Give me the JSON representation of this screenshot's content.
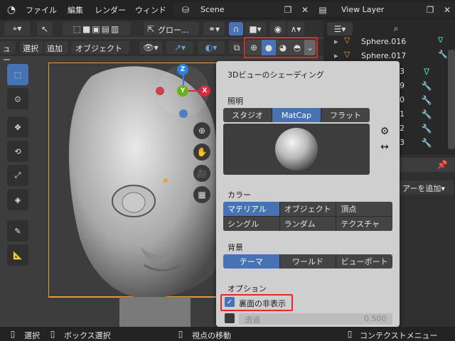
{
  "menubar": {
    "items": [
      "ファイル",
      "編集",
      "レンダー",
      "ウィンド"
    ],
    "scene": "Scene",
    "view_layer": "View Layer"
  },
  "vp_header": {
    "transform": "グロー...",
    "menus": [
      "ュー",
      "選択",
      "追加",
      "オブジェクト"
    ]
  },
  "outliner": {
    "rows": [
      {
        "name": "Sphere.016",
        "tag": ""
      },
      {
        "name": "Sphere.017",
        "tag": ""
      },
      {
        "tag": "3"
      },
      {
        "tag": "9"
      },
      {
        "tag": "0"
      },
      {
        "tag": "1"
      },
      {
        "tag": "2"
      },
      {
        "tag": "3"
      }
    ]
  },
  "props": {
    "add_label": "アーを追加"
  },
  "gizmo": {
    "z": "Z",
    "y": "Y",
    "x": "X"
  },
  "popover": {
    "title": "3Dビューのシェーディング",
    "lighting": {
      "label": "照明",
      "options": [
        "スタジオ",
        "MatCap",
        "フラット"
      ],
      "selected": "MatCap"
    },
    "color": {
      "label": "カラー",
      "options": [
        "マテリアル",
        "オブジェクト",
        "頂点",
        "シングル",
        "ランダム",
        "テクスチャ"
      ],
      "selected": "マテリアル"
    },
    "background": {
      "label": "背景",
      "options": [
        "テーマ",
        "ワールド",
        "ビューポート"
      ],
      "selected": "テーマ"
    },
    "options": {
      "label": "オプション",
      "backface_culling": "裏面の非表示",
      "backface_checked": true,
      "xray": "透過",
      "xray_value": "0.500"
    }
  },
  "statusbar": {
    "select": "選択",
    "box_select": "ボックス選択",
    "rotate_view": "視点の移動",
    "context_menu": "コンテクストメニュー"
  },
  "colors": {
    "accent": "#4772b3",
    "highlight_red": "#e02a2a",
    "axis_x": "#e0283c",
    "axis_y": "#6cb01e",
    "axis_z": "#2d7fe0"
  }
}
